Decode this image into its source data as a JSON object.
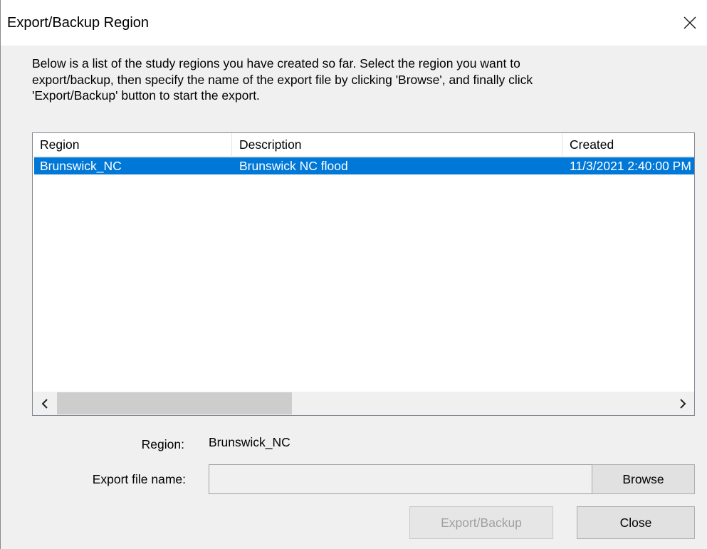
{
  "window": {
    "title": "Export/Backup Region",
    "close_icon": "close-icon"
  },
  "intro_text": "Below is a list of the study regions you have created so far.  Select the region you want to\nexport/backup, then specify the name of the export file by clicking 'Browse', and finally click\n'Export/Backup' button to start the export.",
  "list": {
    "columns": [
      "Region",
      "Description",
      "Created"
    ],
    "rows": [
      {
        "region": "Brunswick_NC",
        "description": "Brunswick NC flood",
        "created": "11/3/2021 2:40:00 PM",
        "selected": true
      }
    ],
    "selection_color": "#0078d7",
    "scroll_left_icon": "chevron-left-icon",
    "scroll_right_icon": "chevron-right-icon"
  },
  "form": {
    "region_label": "Region:",
    "region_value": "Brunswick_NC",
    "export_file_label": "Export file name:",
    "export_file_value": "",
    "browse_label": "Browse"
  },
  "buttons": {
    "export_label": "Export/Backup",
    "export_enabled": false,
    "close_label": "Close"
  }
}
